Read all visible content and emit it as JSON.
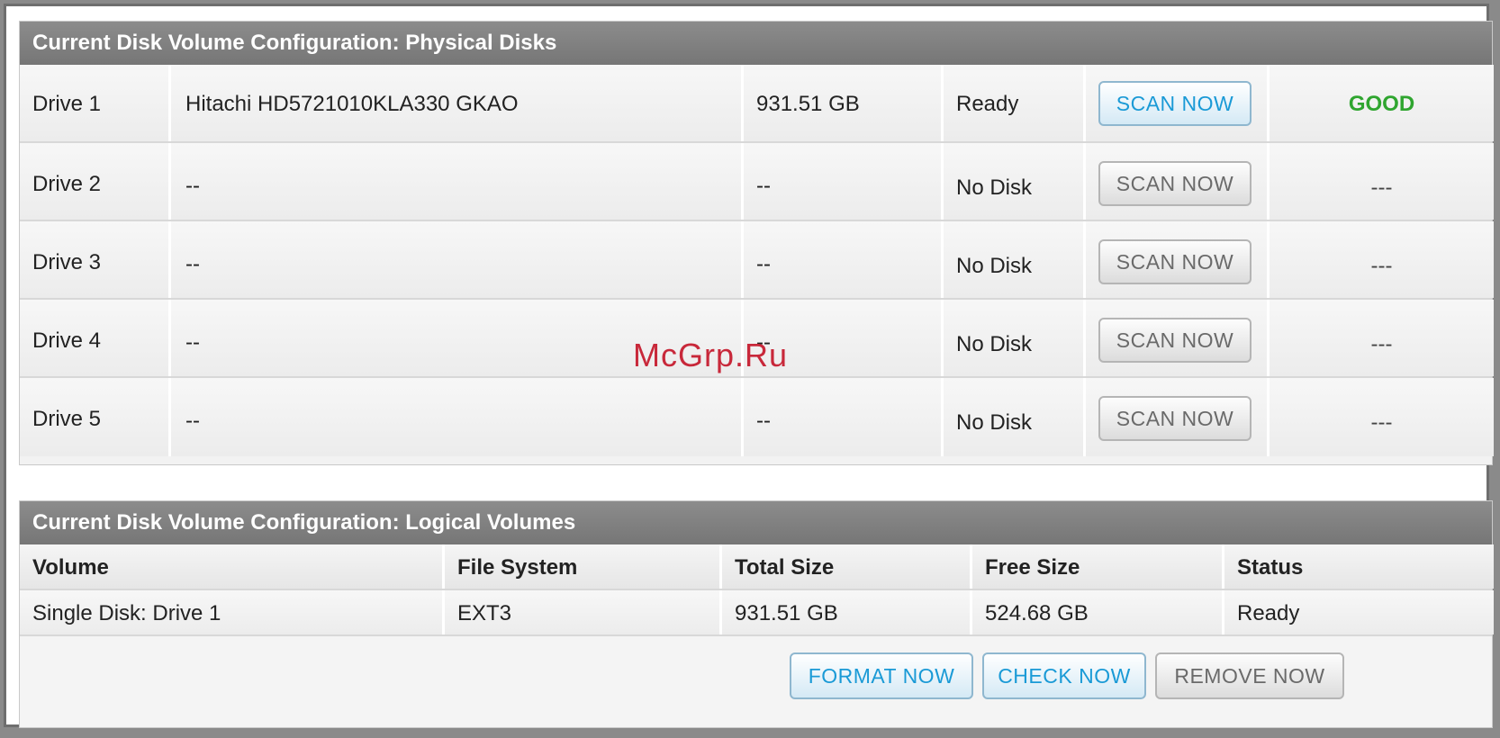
{
  "physical": {
    "title": "Current Disk Volume Configuration: Physical Disks",
    "drives": [
      {
        "name": "Drive 1",
        "model": "Hitachi HD5721010KLA330 GKAO",
        "size": "931.51 GB",
        "status": "Ready",
        "scan_label": "SCAN NOW",
        "health": "GOOD"
      },
      {
        "name": "Drive 2",
        "model": "--",
        "size": "--",
        "status": "No Disk",
        "scan_label": "SCAN NOW",
        "health": "---"
      },
      {
        "name": "Drive 3",
        "model": "--",
        "size": "--",
        "status": "No Disk",
        "scan_label": "SCAN NOW",
        "health": "---"
      },
      {
        "name": "Drive 4",
        "model": "--",
        "size": "--",
        "status": "No Disk",
        "scan_label": "SCAN NOW",
        "health": "---"
      },
      {
        "name": "Drive 5",
        "model": "--",
        "size": "--",
        "status": "No Disk",
        "scan_label": "SCAN NOW",
        "health": "---"
      }
    ]
  },
  "logical": {
    "title": "Current Disk Volume Configuration: Logical Volumes",
    "columns": [
      "Volume",
      "File System",
      "Total Size",
      "Free Size",
      "Status"
    ],
    "rows": [
      [
        "Single Disk: Drive 1",
        "EXT3",
        "931.51 GB",
        "524.68 GB",
        "Ready"
      ]
    ],
    "buttons": {
      "format": "FORMAT NOW",
      "check": "CHECK NOW",
      "remove": "REMOVE NOW"
    }
  },
  "watermark": "McGrp.Ru",
  "colors": {
    "header_bg": "#808080",
    "active_button_text": "#1a9ad6",
    "good_status": "#2fa52f",
    "watermark": "#c8283a"
  }
}
